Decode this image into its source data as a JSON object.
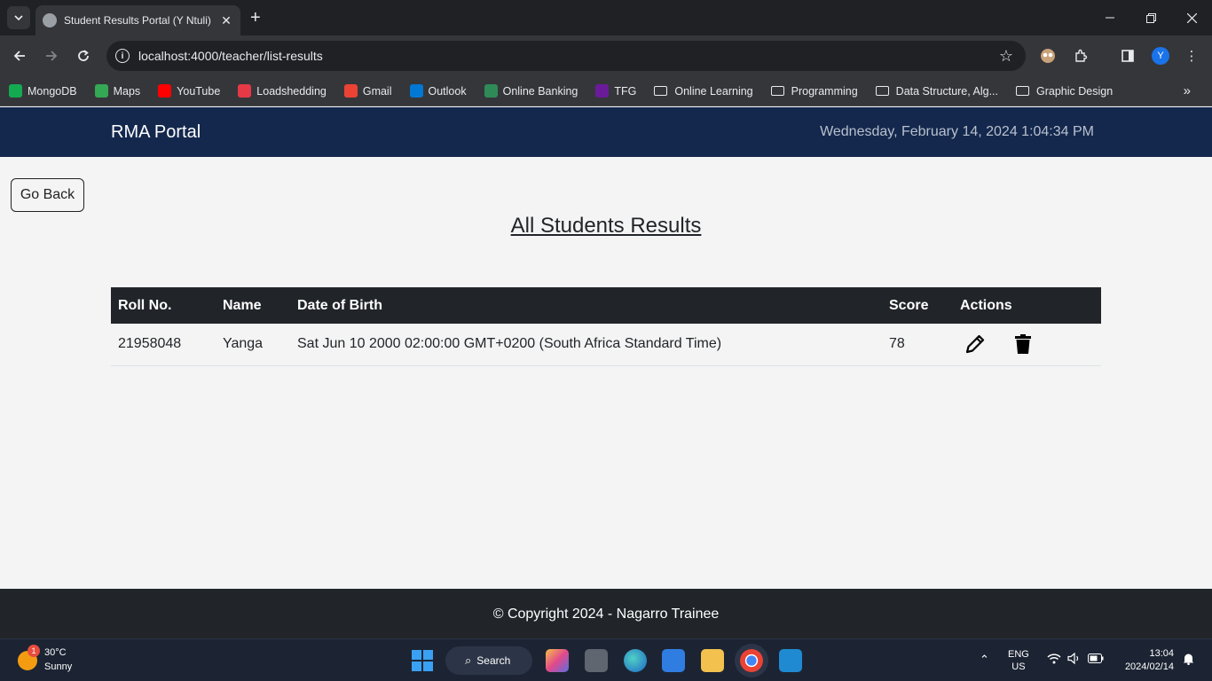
{
  "browser": {
    "tab_title": "Student Results Portal (Y Ntuli)",
    "url": "localhost:4000/teacher/list-results",
    "profile_initial": "Y",
    "bookmarks": [
      {
        "label": "MongoDB",
        "color": "#13aa52",
        "type": "site"
      },
      {
        "label": "Maps",
        "color": "#34a853",
        "type": "site"
      },
      {
        "label": "YouTube",
        "color": "#ff0000",
        "type": "site"
      },
      {
        "label": "Loadshedding",
        "color": "#e63946",
        "type": "site"
      },
      {
        "label": "Gmail",
        "color": "#ea4335",
        "type": "site"
      },
      {
        "label": "Outlook",
        "color": "#0078d4",
        "type": "site"
      },
      {
        "label": "Online Banking",
        "color": "#2e8b57",
        "type": "site"
      },
      {
        "label": "TFG",
        "color": "#6a1b9a",
        "type": "site"
      },
      {
        "label": "Online Learning",
        "type": "folder"
      },
      {
        "label": "Programming",
        "type": "folder"
      },
      {
        "label": "Data Structure, Alg...",
        "type": "folder"
      },
      {
        "label": "Graphic Design",
        "type": "folder"
      }
    ]
  },
  "app": {
    "brand": "RMA Portal",
    "datetime": "Wednesday, February 14, 2024 1:04:34 PM",
    "go_back_label": "Go Back",
    "heading": "All Students Results",
    "table": {
      "headers": [
        "Roll No.",
        "Name",
        "Date of Birth",
        "Score",
        "Actions"
      ],
      "rows": [
        {
          "roll_no": "21958048",
          "name": "Yanga",
          "dob": "Sat Jun 10 2000 02:00:00 GMT+0200 (South Africa Standard Time)",
          "score": "78"
        }
      ]
    },
    "footer": "© Copyright 2024 - Nagarro Trainee"
  },
  "taskbar": {
    "weather_badge": "1",
    "temperature": "30°C",
    "condition": "Sunny",
    "search_label": "Search",
    "language": "ENG",
    "region": "US",
    "time": "13:04",
    "date": "2024/02/14"
  },
  "colors": {
    "app_bar": "#14284e",
    "table_header": "#212529",
    "footer": "#212529"
  }
}
